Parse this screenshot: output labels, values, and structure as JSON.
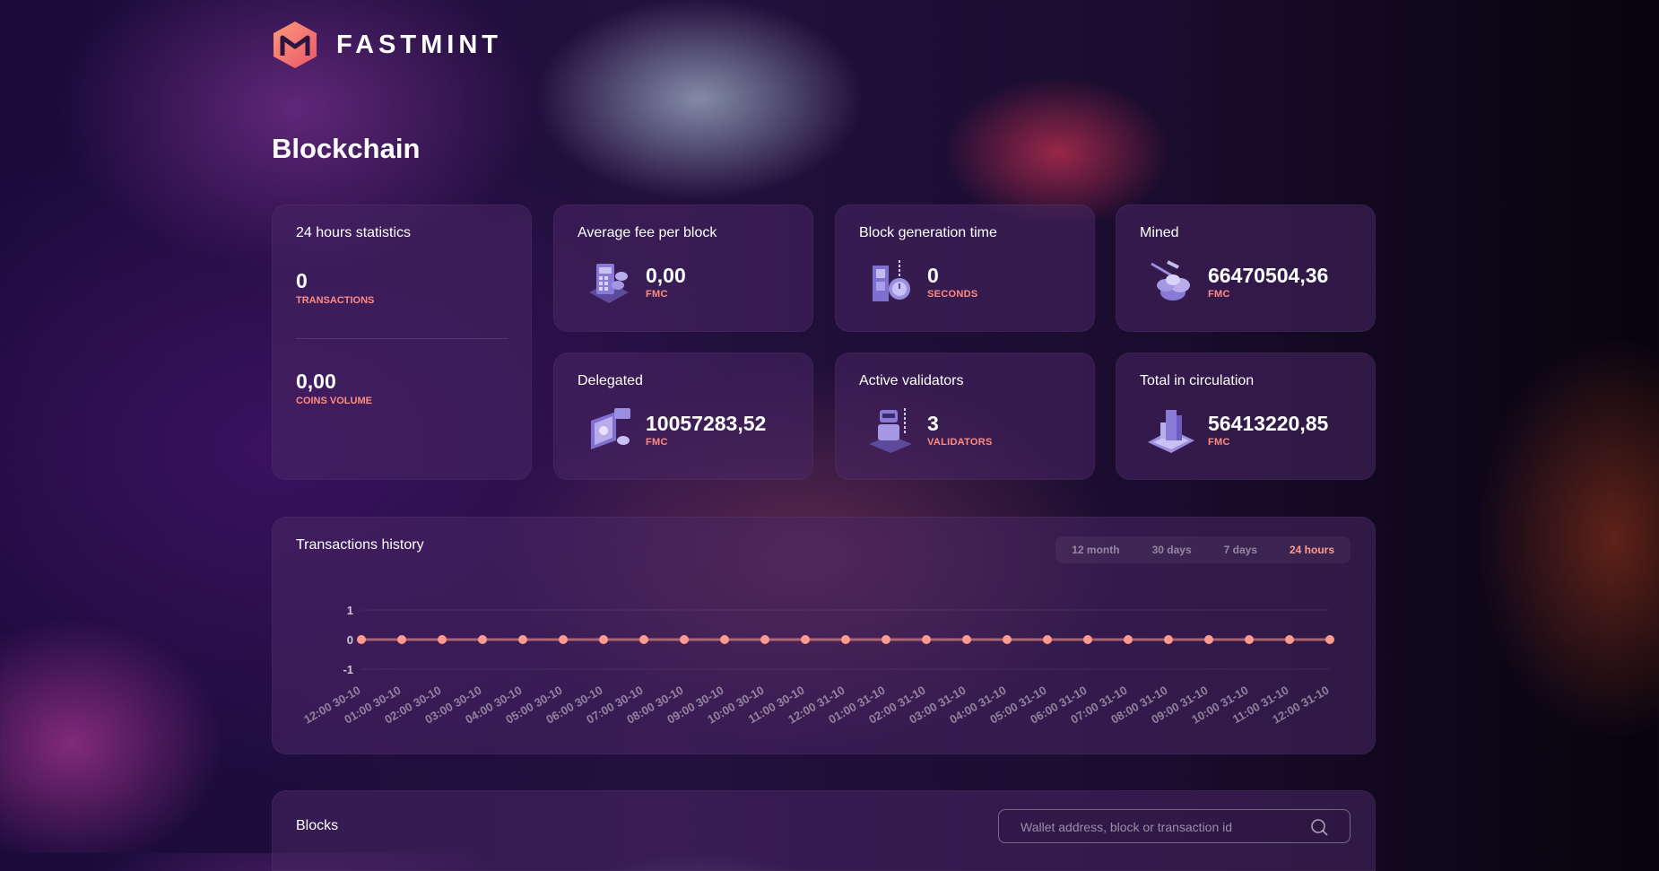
{
  "brand": {
    "name": "FASTMINT"
  },
  "page": {
    "title": "Blockchain"
  },
  "stats24": {
    "title": "24 hours statistics",
    "transactions_value": "0",
    "transactions_label": "TRANSACTIONS",
    "volume_value": "0,00",
    "volume_label": "COINS VOLUME"
  },
  "cards": {
    "avg_fee": {
      "title": "Average fee per block",
      "value": "0,00",
      "unit": "FMC",
      "icon": "calculator-coins-icon"
    },
    "block_time": {
      "title": "Block generation time",
      "value": "0",
      "unit": "SECONDS",
      "icon": "block-clock-icon"
    },
    "mined": {
      "title": "Mined",
      "value": "66470504,36",
      "unit": "FMC",
      "icon": "pickaxe-coins-icon"
    },
    "delegated": {
      "title": "Delegated",
      "value": "10057283,52",
      "unit": "FMC",
      "icon": "delegation-screen-icon"
    },
    "validators": {
      "title": "Active validators",
      "value": "3",
      "unit": "VALIDATORS",
      "icon": "validator-robot-icon"
    },
    "circulation": {
      "title": "Total in circulation",
      "value": "56413220,85",
      "unit": "FMC",
      "icon": "tower-tablet-icon"
    }
  },
  "history": {
    "title": "Transactions history",
    "ranges": [
      "12 month",
      "30 days",
      "7 days",
      "24 hours"
    ],
    "active_range": "24 hours"
  },
  "blocks": {
    "title": "Blocks",
    "search_placeholder": "Wallet address, block or transaction id"
  },
  "colors": {
    "accent": "#ff9a8e",
    "card_bg": "#48265f",
    "line": "#ff9a8e"
  },
  "chart_data": {
    "type": "line",
    "x": [
      "12:00 30-10",
      "01:00 30-10",
      "02:00 30-10",
      "03:00 30-10",
      "04:00 30-10",
      "05:00 30-10",
      "06:00 30-10",
      "07:00 30-10",
      "08:00 30-10",
      "09:00 30-10",
      "10:00 30-10",
      "11:00 30-10",
      "12:00 31-10",
      "01:00 31-10",
      "02:00 31-10",
      "03:00 31-10",
      "04:00 31-10",
      "05:00 31-10",
      "06:00 31-10",
      "07:00 31-10",
      "08:00 31-10",
      "09:00 31-10",
      "10:00 31-10",
      "11:00 31-10",
      "12:00 31-10"
    ],
    "values": [
      0,
      0,
      0,
      0,
      0,
      0,
      0,
      0,
      0,
      0,
      0,
      0,
      0,
      0,
      0,
      0,
      0,
      0,
      0,
      0,
      0,
      0,
      0,
      0,
      0
    ],
    "yticks": [
      "1",
      "0",
      "-1"
    ],
    "ylim": [
      -1,
      1
    ],
    "grid": true
  }
}
